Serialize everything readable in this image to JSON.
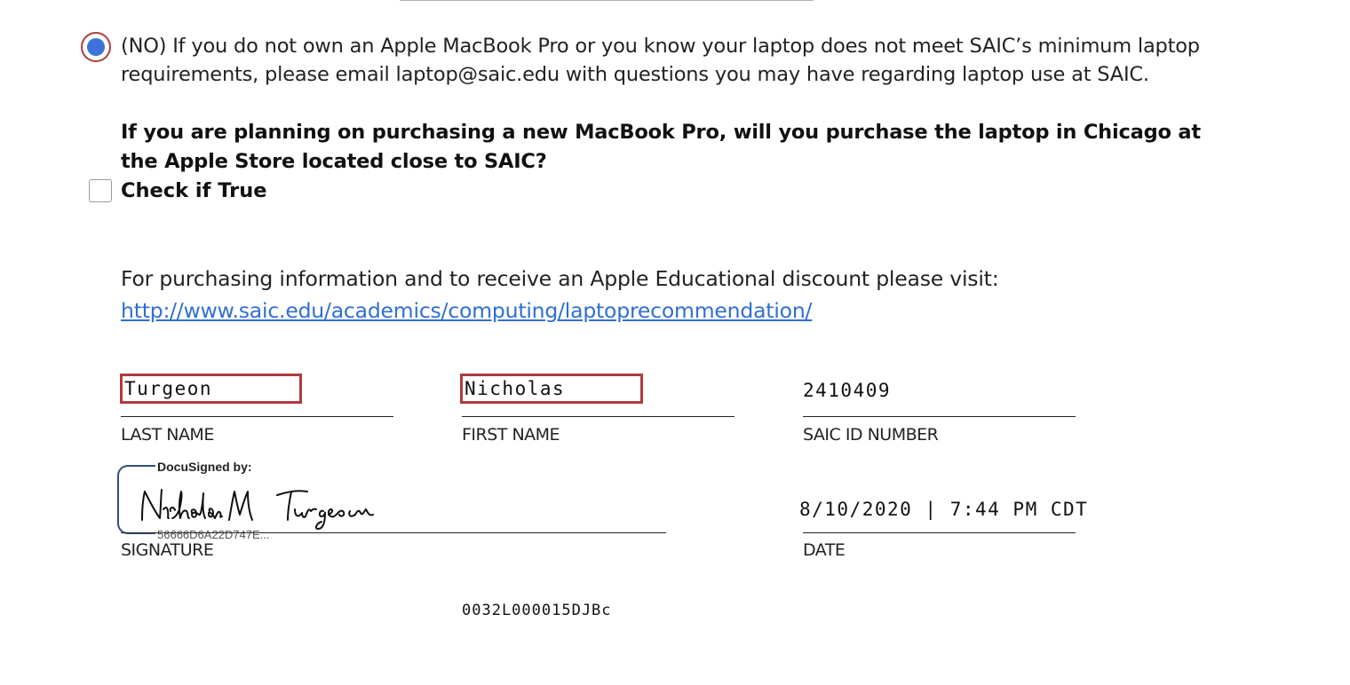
{
  "option_no": {
    "selected": true,
    "text": "(NO) If you do not own an Apple MacBook Pro or you know your laptop does not meet SAIC’s minimum laptop requirements, please email laptop@saic.edu with questions you may have regarding laptop use at SAIC."
  },
  "question": {
    "text": "If you are planning on purchasing a new MacBook Pro, will you purchase the laptop in Chicago at the Apple Store located close to SAIC?",
    "checkbox_label": "Check if True",
    "checked": false
  },
  "purchase_info": {
    "text": "For purchasing information and to receive an Apple Educational discount please visit:",
    "link": "http://www.saic.edu/academics/computing/laptoprecommendation/"
  },
  "fields": {
    "last_name": {
      "value": "Turgeon",
      "label": "LAST NAME"
    },
    "first_name": {
      "value": "Nicholas",
      "label": "FIRST NAME"
    },
    "saic_id": {
      "value": "2410409",
      "label": "SAIC ID NUMBER"
    }
  },
  "signature": {
    "header": "DocuSigned by:",
    "signed_name": "Nicholas M Turgeon",
    "hash": "56666D6A22D747E...",
    "label": "SIGNATURE"
  },
  "date": {
    "value": "8/10/2020 | 7:44 PM CDT",
    "label": "DATE"
  },
  "reference_id": "0032L000015DJBc",
  "colors": {
    "field_border": "#b03a3e",
    "radio_fill": "#3a73d9",
    "link": "#2f6fd1",
    "signature_frame": "#2f4d7a"
  }
}
